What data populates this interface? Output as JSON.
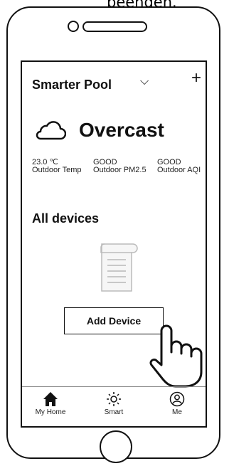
{
  "caption": {
    "text": "beenden."
  },
  "header": {
    "title": "Smarter Pool",
    "chevron": "⌵",
    "add": "+"
  },
  "weather": {
    "icon": "cloud-icon",
    "condition": "Overcast",
    "stats": [
      {
        "value": "23.0 ℃",
        "label": "Outdoor Temp"
      },
      {
        "value": "GOOD",
        "label": "Outdoor PM2.5"
      },
      {
        "value": "GOOD",
        "label": "Outdoor AQI"
      }
    ]
  },
  "devices": {
    "title": "All devices",
    "empty_icon": "document-scroll-icon",
    "add_button": "Add Device",
    "pointer_icon": "hand-pointer-icon"
  },
  "tabs": [
    {
      "label": "My Home",
      "icon": "home-icon",
      "active": true
    },
    {
      "label": "Smart",
      "icon": "sun-icon",
      "active": false
    },
    {
      "label": "Me",
      "icon": "user-icon",
      "active": false
    }
  ]
}
